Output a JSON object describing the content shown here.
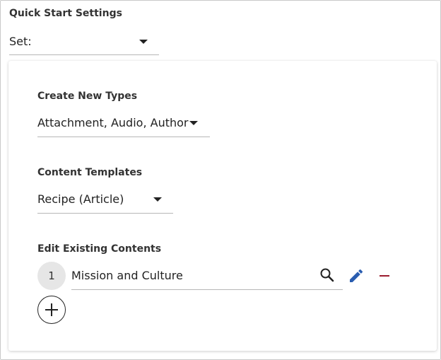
{
  "quick_start": {
    "title": "Quick Start Settings",
    "set_value": "Set:"
  },
  "create_new_types": {
    "title": "Create New Types",
    "value": "Attachment, Audio, Author"
  },
  "content_templates": {
    "title": "Content Templates",
    "value": "Recipe (Article)"
  },
  "edit_existing_contents": {
    "title": "Edit Existing Contents",
    "rows": [
      {
        "index": "1",
        "value": "Mission and Culture"
      }
    ]
  },
  "colors": {
    "edit_icon": "#2a5db0",
    "remove_icon": "#9b1c2e",
    "index_bg": "#e6e6e6"
  },
  "icons": {
    "search": "search-icon",
    "edit": "pencil-icon",
    "remove": "minus-icon",
    "add": "plus-icon",
    "dropdown": "caret-down-icon"
  }
}
